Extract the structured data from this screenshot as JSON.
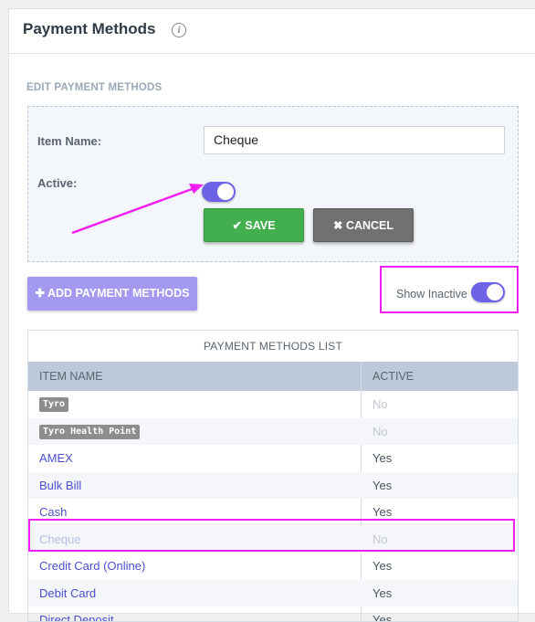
{
  "header": {
    "title": "Payment Methods",
    "info_icon": "info-icon"
  },
  "edit": {
    "section_label": "EDIT PAYMENT METHODS",
    "item_name_label": "Item Name:",
    "item_name_value": "Cheque",
    "active_label": "Active:",
    "active_on": true,
    "save_label": "SAVE",
    "cancel_label": "CANCEL",
    "save_icon": "check-icon",
    "cancel_icon": "x-icon"
  },
  "add_button": {
    "label": "ADD PAYMENT METHODS",
    "icon": "plus-icon"
  },
  "show_inactive": {
    "label": "Show Inactive",
    "on": true
  },
  "list": {
    "title": "PAYMENT METHODS LIST",
    "columns": [
      "ITEM NAME",
      "ACTIVE"
    ],
    "rows": [
      {
        "name": "Tyro",
        "active": "No",
        "tag": true
      },
      {
        "name": "Tyro Health Point",
        "active": "No",
        "tag": true
      },
      {
        "name": "AMEX",
        "active": "Yes"
      },
      {
        "name": "Bulk Bill",
        "active": "Yes"
      },
      {
        "name": "Cash",
        "active": "Yes"
      },
      {
        "name": "Cheque",
        "active": "No"
      },
      {
        "name": "Credit Card (Online)",
        "active": "Yes"
      },
      {
        "name": "Debit Card",
        "active": "Yes"
      },
      {
        "name": "Direct Deposit",
        "active": "Yes"
      }
    ]
  },
  "colors": {
    "accent": "#6e63e6",
    "highlight": "#f31ef3",
    "save": "#42ae4e",
    "cancel": "#717171"
  }
}
